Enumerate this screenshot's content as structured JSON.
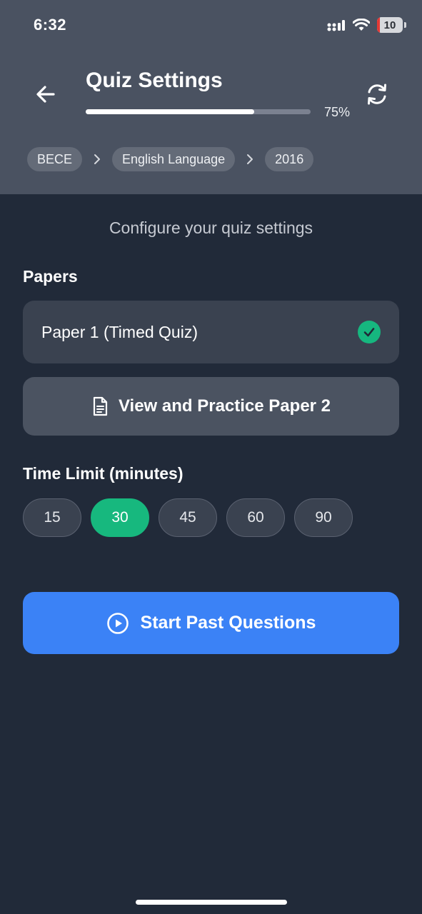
{
  "status_bar": {
    "time": "6:32",
    "battery_level": "10",
    "icons": [
      "signal-icon",
      "wifi-icon",
      "battery-icon"
    ]
  },
  "header": {
    "title": "Quiz Settings",
    "progress_value": 0.75,
    "progress_label": "75%",
    "back_icon": "arrow-left-icon",
    "refresh_icon": "refresh-icon"
  },
  "breadcrumb": [
    "BECE",
    "English Language",
    "2016"
  ],
  "subtitle": "Configure your quiz settings",
  "papers": {
    "label": "Papers",
    "selected_paper": "Paper 1 (Timed Quiz)",
    "practice_button": "View and Practice Paper 2"
  },
  "time_limit": {
    "label": "Time Limit (minutes)",
    "options": [
      "15",
      "30",
      "45",
      "60",
      "90"
    ],
    "selected": "30"
  },
  "start_button": "Start Past Questions",
  "colors": {
    "accent_green": "#17b87e",
    "primary_blue": "#3b82f6",
    "background": "#212a39",
    "header": "#4a5261"
  }
}
